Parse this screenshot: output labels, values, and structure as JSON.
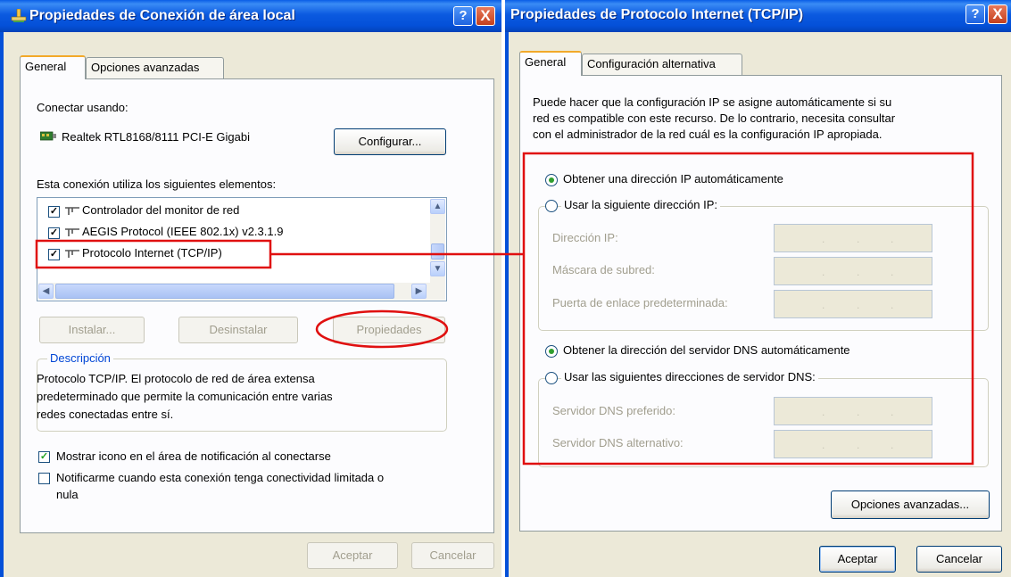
{
  "left_window": {
    "title": "Propiedades de Conexión de área local",
    "help_button": "?",
    "close_button": "X",
    "tabs": [
      "General",
      "Opciones avanzadas"
    ],
    "connect_using_label": "Conectar usando:",
    "adapter_name": "Realtek RTL8168/8111 PCI-E Gigabi",
    "configure_button": "Configurar...",
    "elements_label": "Esta conexión utiliza los siguientes elementos:",
    "items": [
      {
        "label": "Controlador del monitor de red",
        "checked": true
      },
      {
        "label": "AEGIS Protocol (IEEE 802.1x) v2.3.1.9",
        "checked": true
      },
      {
        "label": "Protocolo Internet (TCP/IP)",
        "checked": true,
        "selected": true
      }
    ],
    "install_button": "Instalar...",
    "uninstall_button": "Desinstalar",
    "properties_button": "Propiedades",
    "description_title": "Descripción",
    "description_text": [
      "Protocolo TCP/IP. El protocolo de red de área extensa",
      "predeterminado que permite la comunicación entre varias",
      "redes conectadas entre sí."
    ],
    "show_icon_label": "Mostrar icono en el área de notificación al conectarse",
    "show_icon_checked": true,
    "notify_label_1": "Notificarme cuando esta conexión tenga conectividad limitada o",
    "notify_label_2": "nula",
    "notify_checked": false,
    "ok_button": "Aceptar",
    "cancel_button": "Cancelar"
  },
  "right_window": {
    "title": "Propiedades de Protocolo Internet (TCP/IP)",
    "help_button": "?",
    "close_button": "X",
    "tabs": [
      "General",
      "Configuración alternativa"
    ],
    "intro_text": [
      "Puede hacer que la configuración IP se asigne automáticamente si su",
      "red es compatible con este recurso. De lo contrario, necesita consultar",
      "con el administrador de la red cuál es la configuración IP apropiada."
    ],
    "ip_auto_label": "Obtener una dirección IP automáticamente",
    "ip_auto_selected": true,
    "ip_manual_label": "Usar la siguiente dirección IP:",
    "ip_fields": [
      {
        "label": "Dirección IP:"
      },
      {
        "label": "Máscara de subred:"
      },
      {
        "label": "Puerta de enlace predeterminada:"
      }
    ],
    "dns_auto_label": "Obtener la dirección del servidor DNS automáticamente",
    "dns_auto_selected": true,
    "dns_manual_label": "Usar las siguientes direcciones de servidor DNS:",
    "dns_fields": [
      {
        "label": "Servidor DNS preferido:"
      },
      {
        "label": "Servidor DNS alternativo:"
      }
    ],
    "ip_separator": ".",
    "advanced_button": "Opciones avanzadas...",
    "ok_button": "Aceptar",
    "cancel_button": "Cancelar"
  },
  "colors": {
    "annotation_red": "#e01010",
    "titlebar_blue": "#0450d8",
    "dialog_face": "#ece9d8",
    "selection_blue": "#316ac5"
  }
}
